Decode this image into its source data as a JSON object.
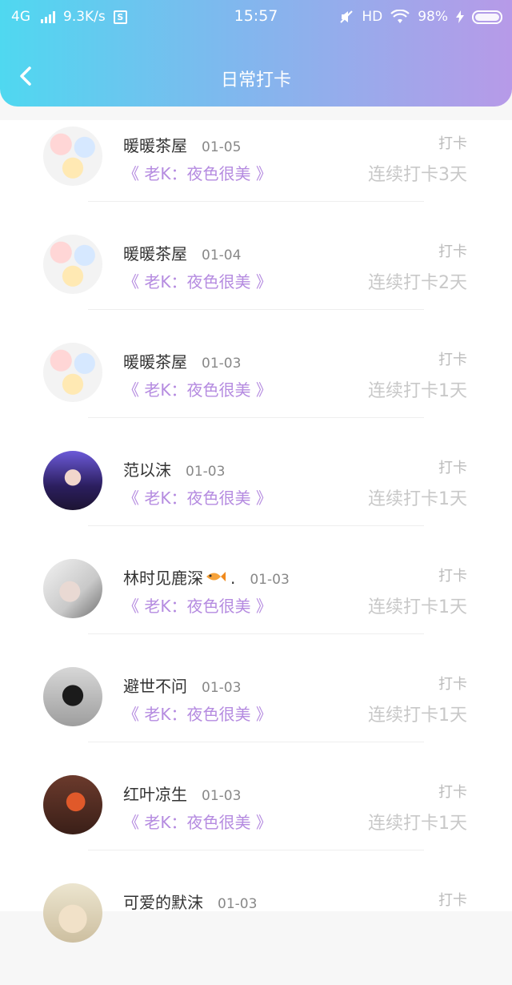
{
  "status_bar": {
    "network": "4G",
    "speed": "9.3K/s",
    "s_icon": "S",
    "time": "15:57",
    "hd": "HD",
    "battery": "98%"
  },
  "nav": {
    "title": "日常打卡"
  },
  "colors": {
    "accent": "#b58be0",
    "header_start": "#4fd8f0",
    "header_end": "#b79ae8"
  },
  "entries": [
    {
      "name": "暖暖茶屋",
      "date": "01-05",
      "song": "《 老K：夜色很美 》",
      "tag": "打卡",
      "streak": "连续打卡3天",
      "avatar": "cartoon-group"
    },
    {
      "name": "暖暖茶屋",
      "date": "01-04",
      "song": "《 老K：夜色很美 》",
      "tag": "打卡",
      "streak": "连续打卡2天",
      "avatar": "cartoon-group"
    },
    {
      "name": "暖暖茶屋",
      "date": "01-03",
      "song": "《 老K：夜色很美 》",
      "tag": "打卡",
      "streak": "连续打卡1天",
      "avatar": "cartoon-group"
    },
    {
      "name": "范以沫",
      "date": "01-03",
      "song": "《 老K：夜色很美 》",
      "tag": "打卡",
      "streak": "连续打卡1天",
      "avatar": "photo-girl"
    },
    {
      "name": "林时见鹿深",
      "suffix": ".",
      "date": "01-03",
      "song": "《 老K：夜色很美 》",
      "tag": "打卡",
      "streak": "连续打卡1天",
      "avatar": "photo-boy"
    },
    {
      "name": "避世不问",
      "date": "01-03",
      "song": "《 老K：夜色很美 》",
      "tag": "打卡",
      "streak": "连续打卡1天",
      "avatar": "photo-mask"
    },
    {
      "name": "红叶凉生",
      "date": "01-03",
      "song": "《 老K：夜色很美 》",
      "tag": "打卡",
      "streak": "连续打卡1天",
      "avatar": "photo-red"
    },
    {
      "name": "可爱的默沫",
      "date": "01-03",
      "song": "",
      "tag": "打卡",
      "streak": "",
      "avatar": "photo-light"
    }
  ]
}
